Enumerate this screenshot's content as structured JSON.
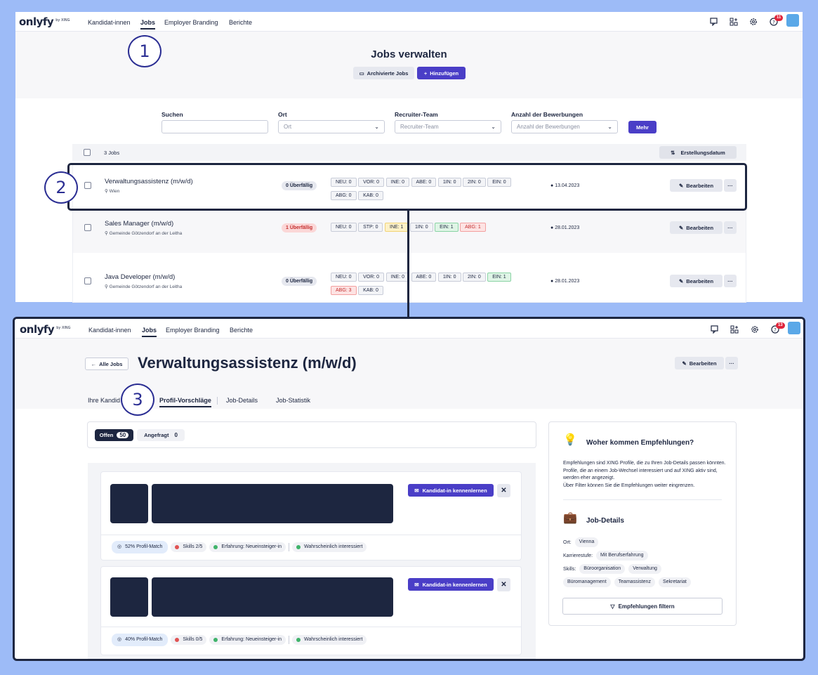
{
  "nav": {
    "logo": "onlyfy",
    "logo_sub": "by XING",
    "items": [
      "Kandidat-innen",
      "Jobs",
      "Employer Branding",
      "Berichte"
    ],
    "notif_count_top": "11",
    "notif_count_bottom": "13"
  },
  "jobs_page": {
    "title": "Jobs verwalten",
    "archive_label": "Archivierte Jobs",
    "add_label": "Hinzufügen",
    "filters": {
      "search_label": "Suchen",
      "search_value": "",
      "location_label": "Ort",
      "location_placeholder": "Ort",
      "team_label": "Recruiter-Team",
      "team_placeholder": "Recruiter-Team",
      "applications_label": "Anzahl der Bewerbungen",
      "applications_placeholder": "Anzahl der Bewerbungen",
      "more_label": "Mehr"
    },
    "count_label": "3 Jobs",
    "sort_label": "Erstellungsdatum",
    "edit_label": "Bearbeiten",
    "more_dots": "···",
    "jobs": [
      {
        "title": "Verwaltungsassistenz (m/w/d)",
        "location": "Wien",
        "overdue": "0 Überfällig",
        "date": "13.04.2023",
        "tags_row1": [
          "NEU: 0",
          "VOR: 0",
          "INE: 0",
          "ABE: 0",
          "1IN: 0",
          "2IN: 0",
          "EIN: 0"
        ],
        "tags_row2": [
          "ABG: 0",
          "KAB: 0"
        ]
      },
      {
        "title": "Sales Manager (m/w/d)",
        "location": "Gemeinde Götzendorf an der Leitha",
        "overdue": "1 Überfällig",
        "date": "28.01.2023",
        "tags_row1": [
          "NEU: 0",
          "STP: 0",
          "INE: 1",
          "1IN: 0",
          "EIN: 1",
          "ABG: 1"
        ],
        "tags_row2": []
      },
      {
        "title": "Java Developer (m/w/d)",
        "location": "Gemeinde Götzendorf an der Leitha",
        "overdue": "0 Überfällig",
        "date": "28.01.2023",
        "tags_row1": [
          "NEU: 0",
          "VOR: 0",
          "INE: 0",
          "ABE: 0",
          "1IN: 0",
          "2IN: 0",
          "EIN: 1"
        ],
        "tags_row2": [
          "ABG: 3",
          "KAB: 0"
        ]
      }
    ]
  },
  "callouts": [
    "1",
    "2",
    "3"
  ],
  "job_detail": {
    "back_label": "Alle Jobs",
    "title": "Verwaltungsassistenz (m/w/d)",
    "edit_label": "Bearbeiten",
    "more_dots": "···",
    "tabs": [
      "Ihre Kandid",
      "Profil-Vorschläge",
      "Job-Details",
      "Job-Statistik"
    ],
    "filter_open_label": "Offen",
    "filter_open_count": "50",
    "filter_asked_label": "Angefragt",
    "filter_asked_count": "0",
    "meet_label": "Kandidat-in kennenlernen",
    "close_glyph": "✕",
    "cards": [
      {
        "match": "52% Profil-Match",
        "skills": "Skills 2/5",
        "experience": "Erfahrung: Neueinsteiger-in",
        "interest": "Wahrscheinlich interessiert"
      },
      {
        "match": "40% Profil-Match",
        "skills": "Skills 0/5",
        "experience": "Erfahrung: Neueinsteiger-in",
        "interest": "Wahrscheinlich interessiert"
      }
    ],
    "side": {
      "reco_title": "Woher kommen Empfehlungen?",
      "reco_text1": "Empfehlungen sind XING Profile, die zu Ihren Job-Details passen könnten. Profile, die an einem Job-Wechsel interessiert und auf XING aktiv sind, werden eher angezeigt.",
      "reco_text2": "Über Filter können Sie die Empfehlungen weiter eingrenzen.",
      "details_title": "Job-Details",
      "ort_label": "Ort:",
      "ort_value": "Vienna",
      "level_label": "Karrierestufe:",
      "level_value": "Mit Berufserfahrung",
      "skills_label": "Skills:",
      "skills": [
        "Büroorganisation",
        "Verwaltung",
        "Büromanagement",
        "Teamassistenz",
        "Sekretariat"
      ],
      "filter_label": "Empfehlungen filtern"
    }
  },
  "colors": {
    "accent": "#4a3ec7",
    "dark": "#1d2640",
    "background": "#9dbbf7"
  }
}
